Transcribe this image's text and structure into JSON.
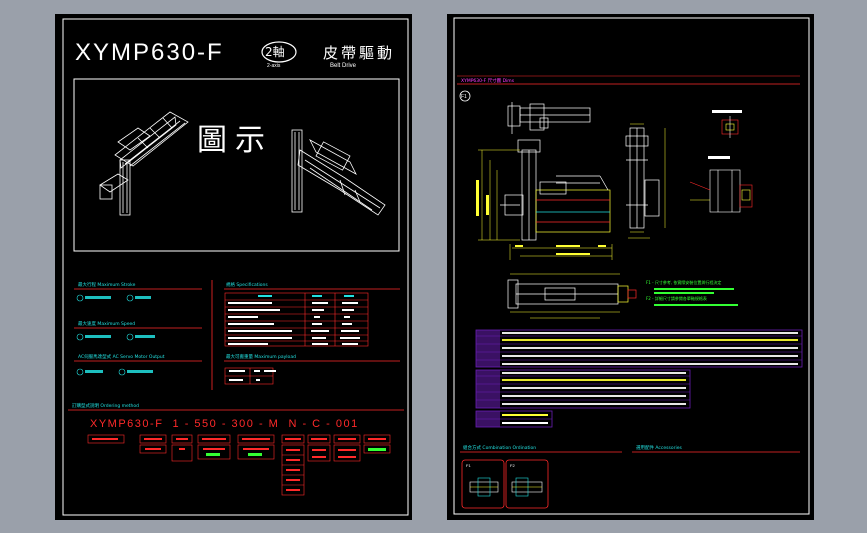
{
  "colors": {
    "background": "#9aa0aa",
    "sheet": "#000000",
    "frame": "#ffffff",
    "red": "#ff2a2a",
    "magenta": "#ff3cff",
    "cyan": "#22e0e0",
    "yellow": "#ffff33",
    "green": "#33ff33",
    "purple": "#6a1fb5"
  },
  "left_sheet": {
    "model": "XYMP630-F",
    "axis_badge": "2軸",
    "axis_badge_sub": "2-axis",
    "drive_cn": "皮帶驅動",
    "drive_en": "Belt Drive",
    "figure_label": "圖示",
    "sections": {
      "max_stroke": "最大行程  Maximum Stroke",
      "max_speed": "最大速度  Maximum Speed",
      "screw_lead": "AC伺服馬達型式  AC Servo Motor Output",
      "specifications": "規格  Specifications",
      "max_payload": "最大可搬重量  Maximum payload",
      "ordering": "訂購型式說明  Ordering method"
    },
    "ordering_code": "XYMP630-F  1 - 550 - 300 - M  N - C - 001"
  },
  "right_sheet": {
    "dimension_title": "XYMP630-F  尺寸圖  Dims",
    "figure_tag": "F1",
    "note_1": "F1 - 尺寸參考, 依實際安裝位置與行程決定",
    "note_2": "F2 - 詳細尺寸請參閱各單軸規格表",
    "combination_title": "組合方式  Combination Ordination",
    "accessories_title": "選用配件  Accessories",
    "combo_labels": [
      "F1",
      "F2"
    ]
  }
}
